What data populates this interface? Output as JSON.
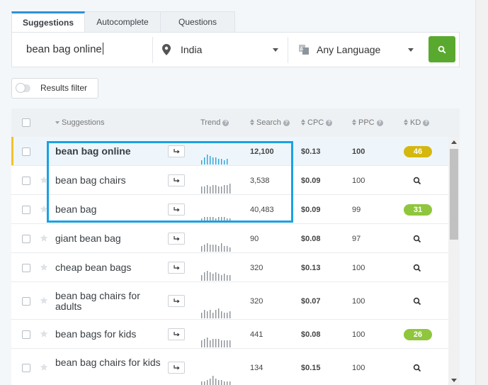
{
  "tabs": [
    {
      "label": "Suggestions",
      "active": true
    },
    {
      "label": "Autocomplete",
      "active": false
    },
    {
      "label": "Questions",
      "active": false
    }
  ],
  "search": {
    "keyword": "bean bag online",
    "location": "India",
    "language": "Any Language"
  },
  "filter": {
    "label": "Results filter",
    "on": false
  },
  "columns": {
    "suggestions": "Suggestions",
    "trend": "Trend",
    "search": "Search",
    "cpc": "CPC",
    "ppc": "PPC",
    "kd": "KD"
  },
  "rows": [
    {
      "keyword": "bean bag online",
      "search": "12,100",
      "cpc": "$0.13",
      "ppc": "100",
      "kd": "46",
      "kd_color": "#d4b80f",
      "trend": [
        3,
        5,
        7,
        6,
        5,
        5,
        4,
        4,
        3,
        4
      ],
      "highlighted": true
    },
    {
      "keyword": "bean bag chairs",
      "search": "3,538",
      "cpc": "$0.09",
      "ppc": "100",
      "kd": "",
      "trend": [
        5,
        5,
        6,
        5,
        6,
        6,
        5,
        5,
        6,
        6,
        7
      ]
    },
    {
      "keyword": "bean bag",
      "search": "40,483",
      "cpc": "$0.09",
      "ppc": "99",
      "kd": "31",
      "kd_color": "#8fc63d",
      "trend": [
        3,
        4,
        4,
        4,
        4,
        3,
        4,
        4,
        4,
        3,
        3
      ]
    },
    {
      "keyword": "giant bean bag",
      "search": "90",
      "cpc": "$0.08",
      "ppc": "97",
      "kd": "",
      "trend": [
        4,
        5,
        6,
        5,
        5,
        5,
        4,
        6,
        4,
        4,
        3
      ]
    },
    {
      "keyword": "cheap bean bags",
      "search": "320",
      "cpc": "$0.13",
      "ppc": "100",
      "kd": "",
      "trend": [
        4,
        6,
        7,
        6,
        5,
        6,
        5,
        4,
        5,
        4,
        4
      ]
    },
    {
      "keyword": "bean bag chairs for adults",
      "search": "320",
      "cpc": "$0.07",
      "ppc": "100",
      "kd": "",
      "trend": [
        4,
        6,
        5,
        6,
        4,
        6,
        7,
        5,
        4,
        4,
        5
      ]
    },
    {
      "keyword": "bean bags for kids",
      "search": "441",
      "cpc": "$0.08",
      "ppc": "100",
      "kd": "26",
      "kd_color": "#8fc63d",
      "trend": [
        5,
        6,
        7,
        5,
        6,
        6,
        6,
        5,
        5,
        5,
        5
      ]
    },
    {
      "keyword": "bean bag chairs for kids",
      "search": "134",
      "cpc": "$0.15",
      "ppc": "100",
      "kd": "",
      "trend": [
        3,
        3,
        4,
        5,
        7,
        5,
        4,
        4,
        3,
        3,
        3
      ]
    }
  ]
}
